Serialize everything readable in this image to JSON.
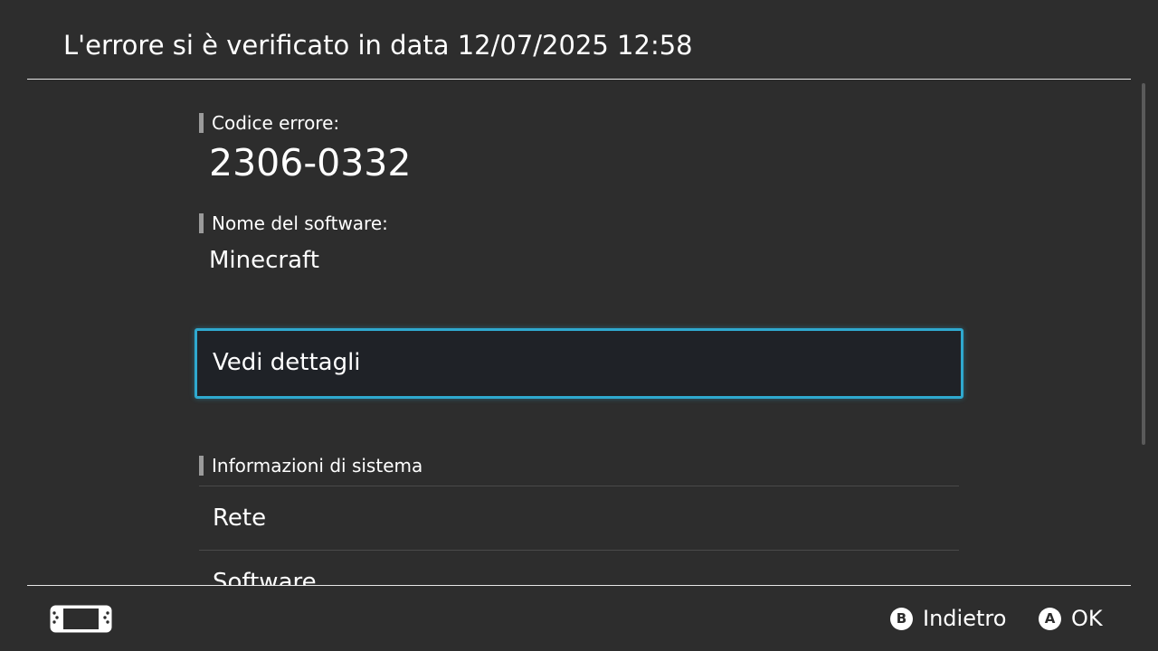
{
  "header": {
    "title": "L'errore si è verificato in data 12/07/2025 12:58"
  },
  "error": {
    "code_label": "Codice errore:",
    "code_value": "2306-0332",
    "software_label": "Nome del software:",
    "software_value": "Minecraft"
  },
  "details_button": {
    "label": "Vedi dettagli"
  },
  "system_info": {
    "heading": "Informazioni di sistema",
    "items": [
      {
        "label": "Rete"
      },
      {
        "label": "Software"
      }
    ]
  },
  "footer": {
    "console_icon": "handheld-console-icon",
    "buttons": [
      {
        "glyph": "B",
        "label": "Indietro"
      },
      {
        "glyph": "A",
        "label": "OK"
      }
    ]
  },
  "colors": {
    "background": "#2d2d2d",
    "focus_border": "#2fa9cf",
    "focus_fill": "#1f2227",
    "text": "#ffffff"
  }
}
